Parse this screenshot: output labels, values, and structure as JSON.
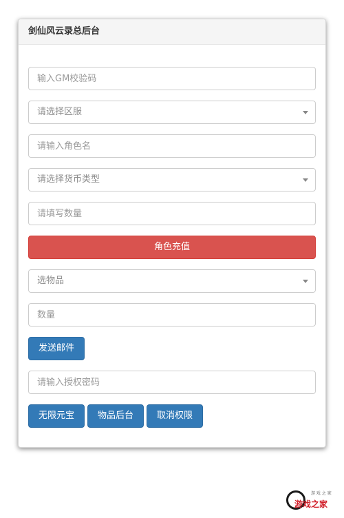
{
  "panel": {
    "title": "剑仙风云录总后台"
  },
  "form": {
    "gm_code_placeholder": "输入GM校验码",
    "server_select": "请选择区服",
    "role_name_placeholder": "请输入角色名",
    "currency_select": "请选择货币类型",
    "amount_placeholder": "请填写数量",
    "recharge_button": "角色充值",
    "item_select": "选物品",
    "item_qty_placeholder": "数量",
    "send_mail_button": "发送邮件",
    "auth_password_placeholder": "请输入授权密码",
    "unlimited_gold_button": "无限元宝",
    "item_backend_button": "物品后台",
    "revoke_permission_button": "取消权限"
  },
  "watermark": {
    "brand": "游戏之家",
    "tagline": "游 戏 之 家"
  },
  "colors": {
    "danger": "#d9534f",
    "primary": "#337ab7",
    "logo_red": "#d11f2a"
  }
}
